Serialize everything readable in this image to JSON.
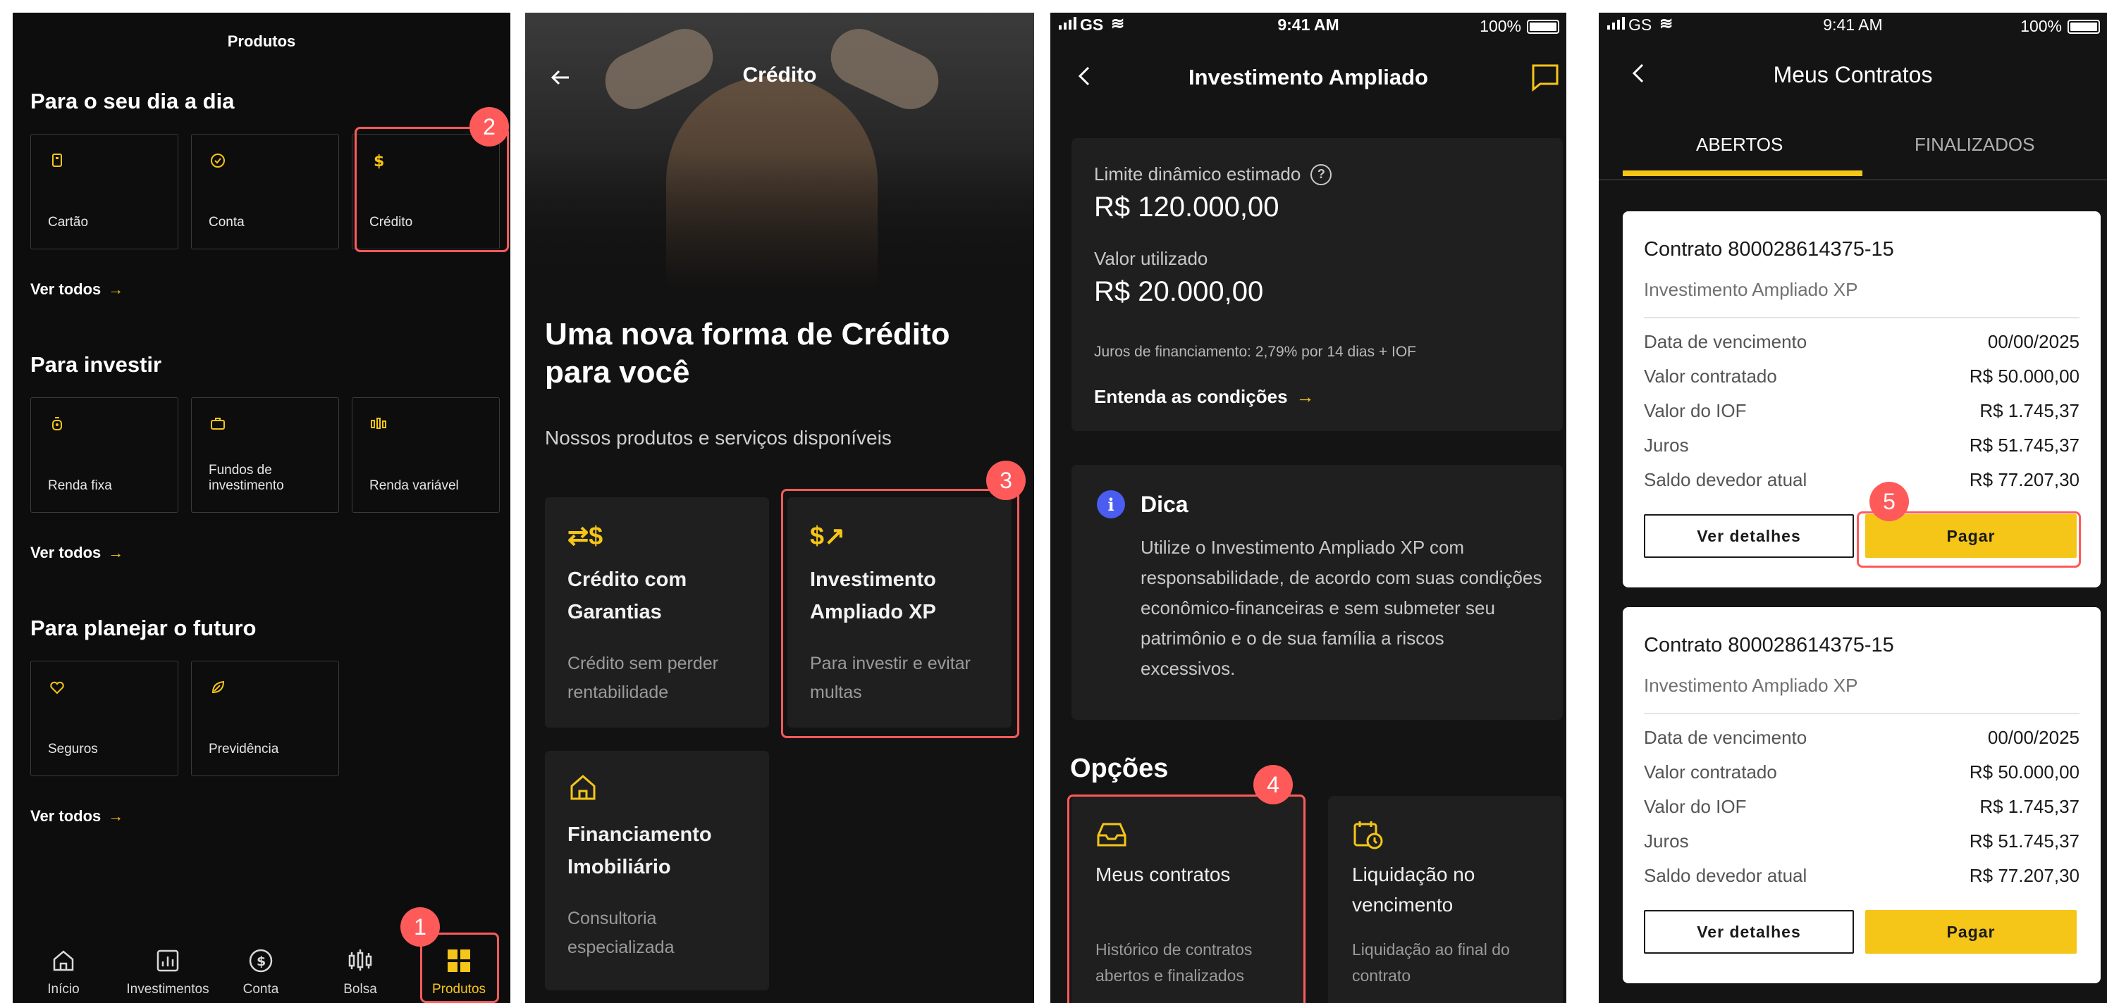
{
  "screen1": {
    "title": "Produtos",
    "sections": [
      {
        "title": "Para o seu dia a dia",
        "tiles": [
          "Cartão",
          "Conta",
          "Crédito"
        ],
        "see_all": "Ver todos"
      },
      {
        "title": "Para investir",
        "tiles": [
          "Renda fixa",
          "Fundos de investimento",
          "Renda variável"
        ],
        "see_all": "Ver todos"
      },
      {
        "title": "Para planejar o futuro",
        "tiles": [
          "Seguros",
          "Previdência"
        ],
        "see_all": "Ver todos"
      }
    ],
    "nav": [
      "Início",
      "Investimentos",
      "Conta",
      "Bolsa",
      "Produtos"
    ]
  },
  "screen2": {
    "title": "Crédito",
    "headline": "Uma nova forma de Crédito para você",
    "subtitle": "Nossos produtos e serviços disponíveis",
    "cards": [
      {
        "title": "Crédito com Garantias",
        "desc": "Crédito sem perder rentabilidade"
      },
      {
        "title": "Investimento Ampliado XP",
        "desc": "Para investir e evitar multas"
      },
      {
        "title": "Financiamento Imobiliário",
        "desc": "Consultoria especializada"
      }
    ]
  },
  "screen3": {
    "status": {
      "carrier": "GS",
      "time": "9:41 AM",
      "battery": "100%"
    },
    "title": "Investimento Ampliado",
    "limit_label": "Limite dinâmico estimado",
    "limit_value": "R$ 120.000,00",
    "used_label": "Valor utilizado",
    "used_value": "R$ 20.000,00",
    "interest_note": "Juros de financiamento: 2,79% por 14 dias + IOF",
    "conditions_link": "Entenda as condições",
    "tip_title": "Dica",
    "tip_text": "Utilize o Investimento Ampliado XP com responsabilidade, de acordo com suas condições econômico-financeiras e sem submeter seu patrimônio e o de sua família a riscos excessivos.",
    "options_title": "Opções",
    "options": [
      {
        "title": "Meus contratos",
        "desc": "Histórico de contratos abertos e finalizados"
      },
      {
        "title": "Liquidação no vencimento",
        "desc": "Liquidação ao final do contrato"
      }
    ]
  },
  "screen4": {
    "status": {
      "carrier": "GS",
      "time": "9:41 AM",
      "battery": "100%"
    },
    "title": "Meus Contratos",
    "tabs": [
      "ABERTOS",
      "FINALIZADOS"
    ],
    "contracts": [
      {
        "title": "Contrato 800028614375-15",
        "product": "Investimento Ampliado XP",
        "rows": [
          {
            "label": "Data de vencimento",
            "value": "00/00/2025"
          },
          {
            "label": "Valor contratado",
            "value": "R$ 50.000,00"
          },
          {
            "label": "Valor do IOF",
            "value": "R$ 1.745,37"
          },
          {
            "label": "Juros",
            "value": "R$ 51.745,37"
          },
          {
            "label": "Saldo devedor atual",
            "value": "R$ 77.207,30"
          }
        ],
        "details_button": "Ver detalhes",
        "pay_button": "Pagar"
      },
      {
        "title": "Contrato 800028614375-15",
        "product": "Investimento Ampliado XP",
        "rows": [
          {
            "label": "Data de vencimento",
            "value": "00/00/2025"
          },
          {
            "label": "Valor contratado",
            "value": "R$ 50.000,00"
          },
          {
            "label": "Valor do IOF",
            "value": "R$ 1.745,37"
          },
          {
            "label": "Juros",
            "value": "R$ 51.745,37"
          },
          {
            "label": "Saldo devedor atual",
            "value": "R$ 77.207,30"
          }
        ],
        "details_button": "Ver detalhes",
        "pay_button": "Pagar"
      }
    ]
  },
  "annotations": [
    "1",
    "2",
    "3",
    "4",
    "5"
  ],
  "colors": {
    "accent": "#f5c518",
    "annotation": "#ff5a5a",
    "background": "#101010",
    "card": "#1f1f1f"
  }
}
